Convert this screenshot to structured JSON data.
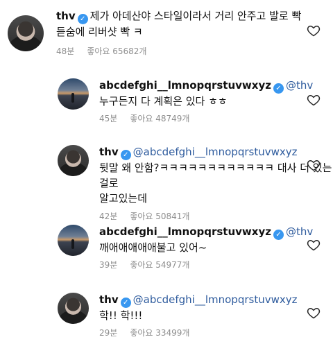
{
  "comments": [
    {
      "username": "thv",
      "verified_icon": "verified-badge-icon",
      "text_line1": "제가 아데산야 스타일이라서 거리 안주고 발로 빡",
      "text_line2": "듣숨에 리버샷 빡 ㅋ",
      "time": "48분",
      "likes": "좋아요 65682개"
    },
    {
      "username": "abcdefghi__lmnopqrstuvwxyz",
      "mention": "@thv",
      "text_line1": "누구든지 다 계획은 있다 ㅎㅎ",
      "time": "45분",
      "likes": "좋아요 48749개"
    },
    {
      "username": "thv",
      "mention": "@abcdefghi__lmnopqrstuvwxyz",
      "text_line1": "뒷말 왜 안함?ㅋㅋㅋㅋㅋㅋㅋㅋㅋㅋㅋㅋ 대사 더 있는걸로",
      "text_line2": "알고있는데",
      "time": "42분",
      "likes": "좋아요 50841개"
    },
    {
      "username": "abcdefghi__lmnopqrstuvwxyz",
      "mention": "@thv",
      "text_line1": "깨애애애애애불고 있어~",
      "time": "39분",
      "likes": "좋아요 54977개"
    },
    {
      "username": "thv",
      "mention": "@abcdefghi__lmnopqrstuvwxyz",
      "text_line1": "학!! 학!!!",
      "time": "29분",
      "likes": "좋아요 33499개"
    }
  ]
}
